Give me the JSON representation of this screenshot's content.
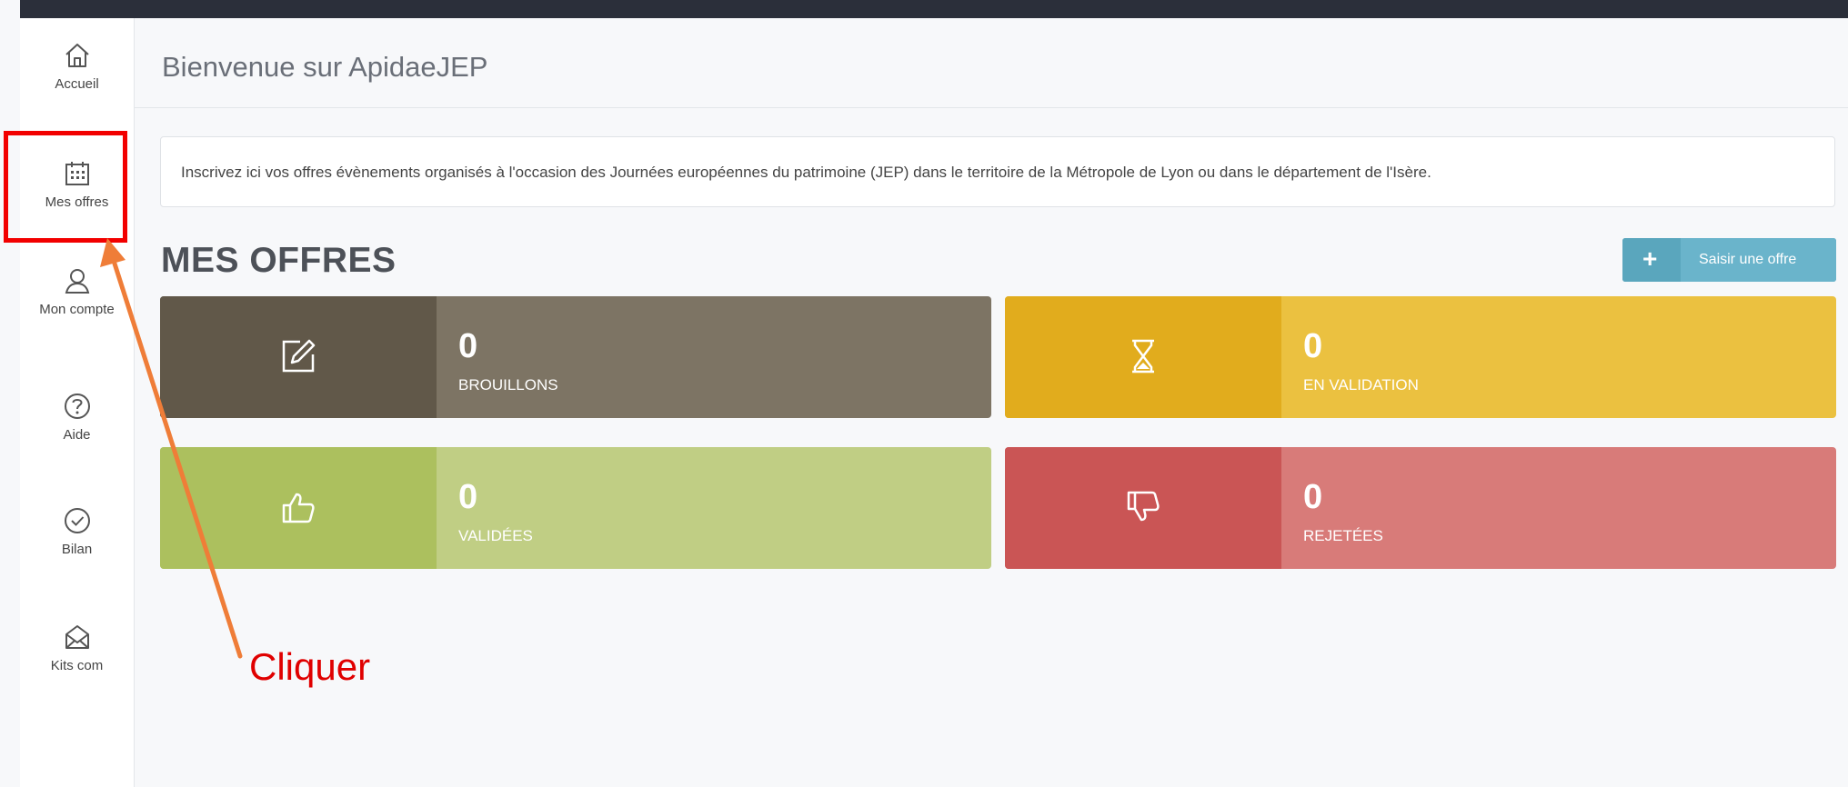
{
  "sidebar": {
    "items": [
      {
        "label": "Accueil",
        "icon": "home-icon"
      },
      {
        "label": "Mes offres",
        "icon": "calendar-icon"
      },
      {
        "label": "Mon compte",
        "icon": "user-icon"
      },
      {
        "label": "Aide",
        "icon": "help-icon"
      },
      {
        "label": "Bilan",
        "icon": "check-circle-icon"
      },
      {
        "label": "Kits com",
        "icon": "envelope-icon"
      }
    ]
  },
  "header": {
    "title": "Bienvenue sur ApidaeJEP"
  },
  "info": {
    "text": "Inscrivez ici vos offres évènements organisés à l'occasion des Journées européennes du patrimoine (JEP) dans le territoire de la Métropole de Lyon ou dans le département de l'Isère."
  },
  "offers": {
    "title": "MES OFFRES",
    "add_button": {
      "icon": "+",
      "label": "Saisir une offre"
    },
    "tiles": [
      {
        "value": "0",
        "label": "BROUILLONS",
        "icon": "edit-icon",
        "dark": "#615849",
        "light": "#7d7464"
      },
      {
        "value": "0",
        "label": "EN VALIDATION",
        "icon": "hourglass-icon",
        "dark": "#e1ac1d",
        "light": "#ebc140"
      },
      {
        "value": "0",
        "label": "VALIDÉES",
        "icon": "thumbs-up-icon",
        "dark": "#acc05e",
        "light": "#c0ce84"
      },
      {
        "value": "0",
        "label": "REJETÉES",
        "icon": "thumbs-down-icon",
        "dark": "#ca5555",
        "light": "#d87b79"
      }
    ]
  },
  "annotation": {
    "text": "Cliquer",
    "color": "#e00000",
    "arrow_color": "#ef7d38"
  }
}
